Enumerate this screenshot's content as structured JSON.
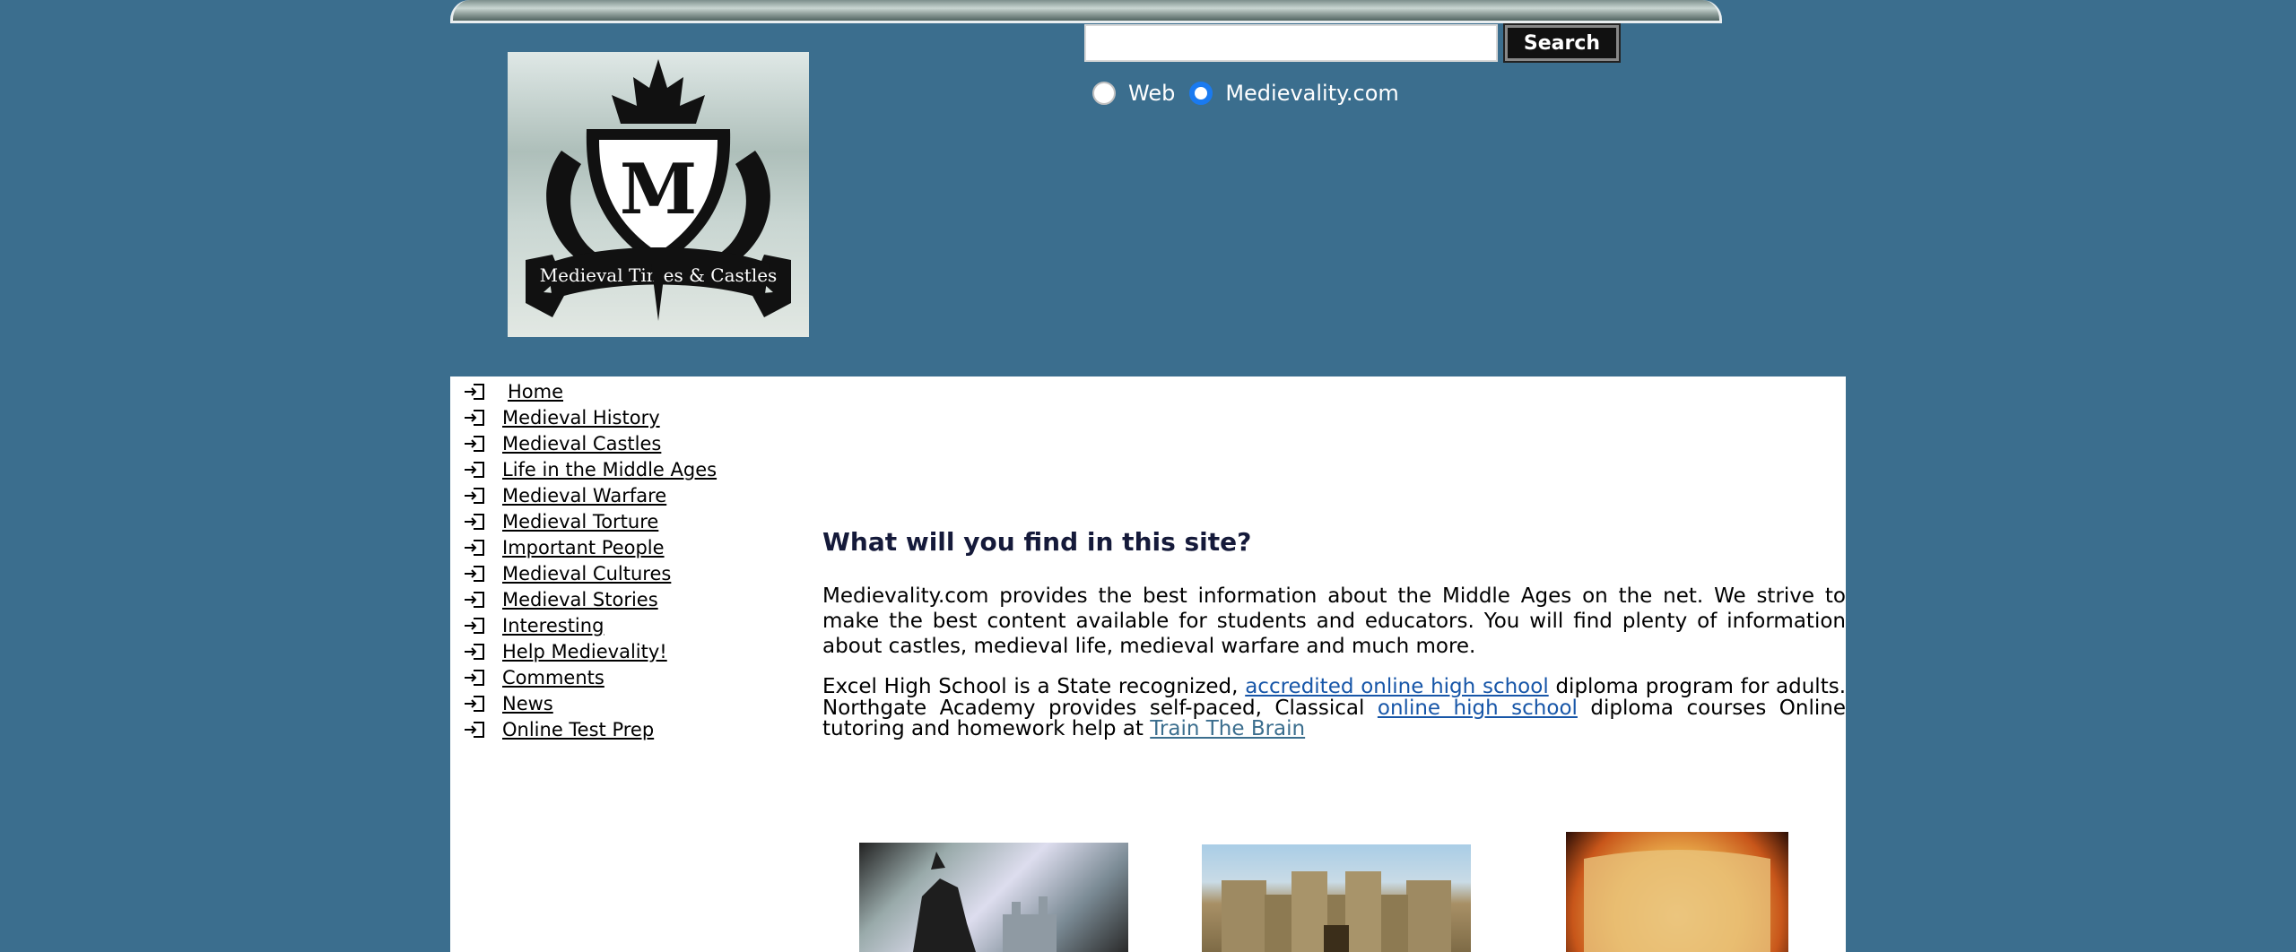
{
  "search": {
    "value": "",
    "button_label": "Search",
    "radio_options": [
      {
        "label": "Web",
        "checked": false
      },
      {
        "label": "Medievality.com",
        "checked": true
      }
    ]
  },
  "logo": {
    "letter": "M",
    "banner_text": "Medieval Times & Castles"
  },
  "nav": {
    "items": [
      {
        "label": "Home"
      },
      {
        "label": "Medieval History"
      },
      {
        "label": "Medieval Castles"
      },
      {
        "label": "Life in the Middle Ages"
      },
      {
        "label": "Medieval Warfare"
      },
      {
        "label": "Medieval Torture"
      },
      {
        "label": "Important People"
      },
      {
        "label": "Medieval Cultures"
      },
      {
        "label": "Medieval Stories"
      },
      {
        "label": "Interesting"
      },
      {
        "label": "Help Medievality!"
      },
      {
        "label": "Comments"
      },
      {
        "label": "News"
      },
      {
        "label": "Online Test Prep"
      }
    ]
  },
  "main": {
    "heading": "What will you find in this site?",
    "intro": "Medievality.com provides the best information about the Middle Ages on the net. We strive to make the best content available for students and educators. You will find plenty of information about castles, medieval life, medieval warfare and much more.",
    "promo": {
      "text1": "Excel High School is a State recognized, ",
      "link1": "accredited online high school",
      "text2": " diploma program for adults. Northgate Academy provides self-paced, Classical ",
      "link2": "online high school",
      "text3": " diploma courses Online tutoring and homework help at ",
      "link3": "Train The Brain"
    }
  },
  "colors": {
    "page_background": "#3b6e8e",
    "link": "#1756a8",
    "heading": "#151a3a",
    "radio_selected": "#1a7af0"
  },
  "icons": {
    "nav_item": "login-arrow-icon"
  }
}
